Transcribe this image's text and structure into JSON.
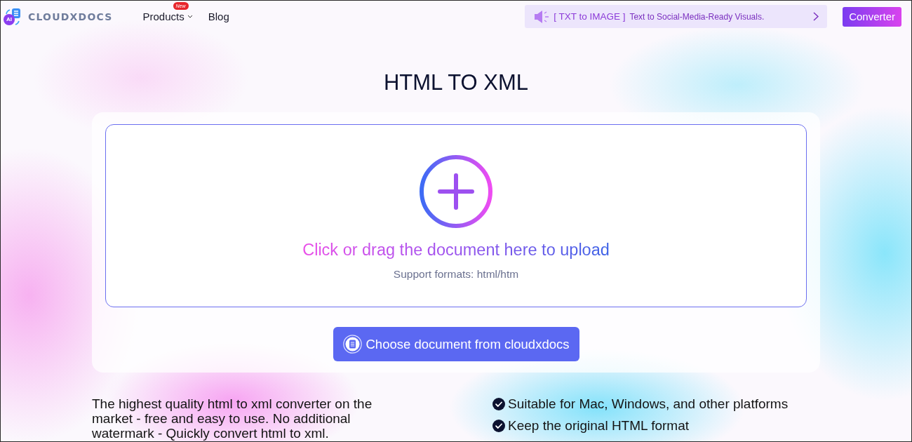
{
  "header": {
    "logo": {
      "badge": "AI",
      "name": "CLOUDXDOCS"
    },
    "nav": [
      {
        "label": "Products",
        "kind": "menu",
        "badge": "New"
      },
      {
        "label": "Blog",
        "kind": "link"
      }
    ],
    "banner": {
      "tag": "[ TXT to IMAGE ]",
      "text": "Text to Social-Media-Ready Visuals."
    },
    "cta": "Converter"
  },
  "title": "HTML TO XML",
  "upload": {
    "prompt": "Click or drag the document here to upload",
    "formats": "Support formats: html/htm",
    "button": "Choose document from cloudxdocs"
  },
  "description": "The highest quality html to xml converter on the market - free and easy to use. No additional watermark - Quickly convert html to xml.",
  "features": [
    "Suitable for Mac, Windows, and other platforms",
    "Keep the original HTML format"
  ]
}
